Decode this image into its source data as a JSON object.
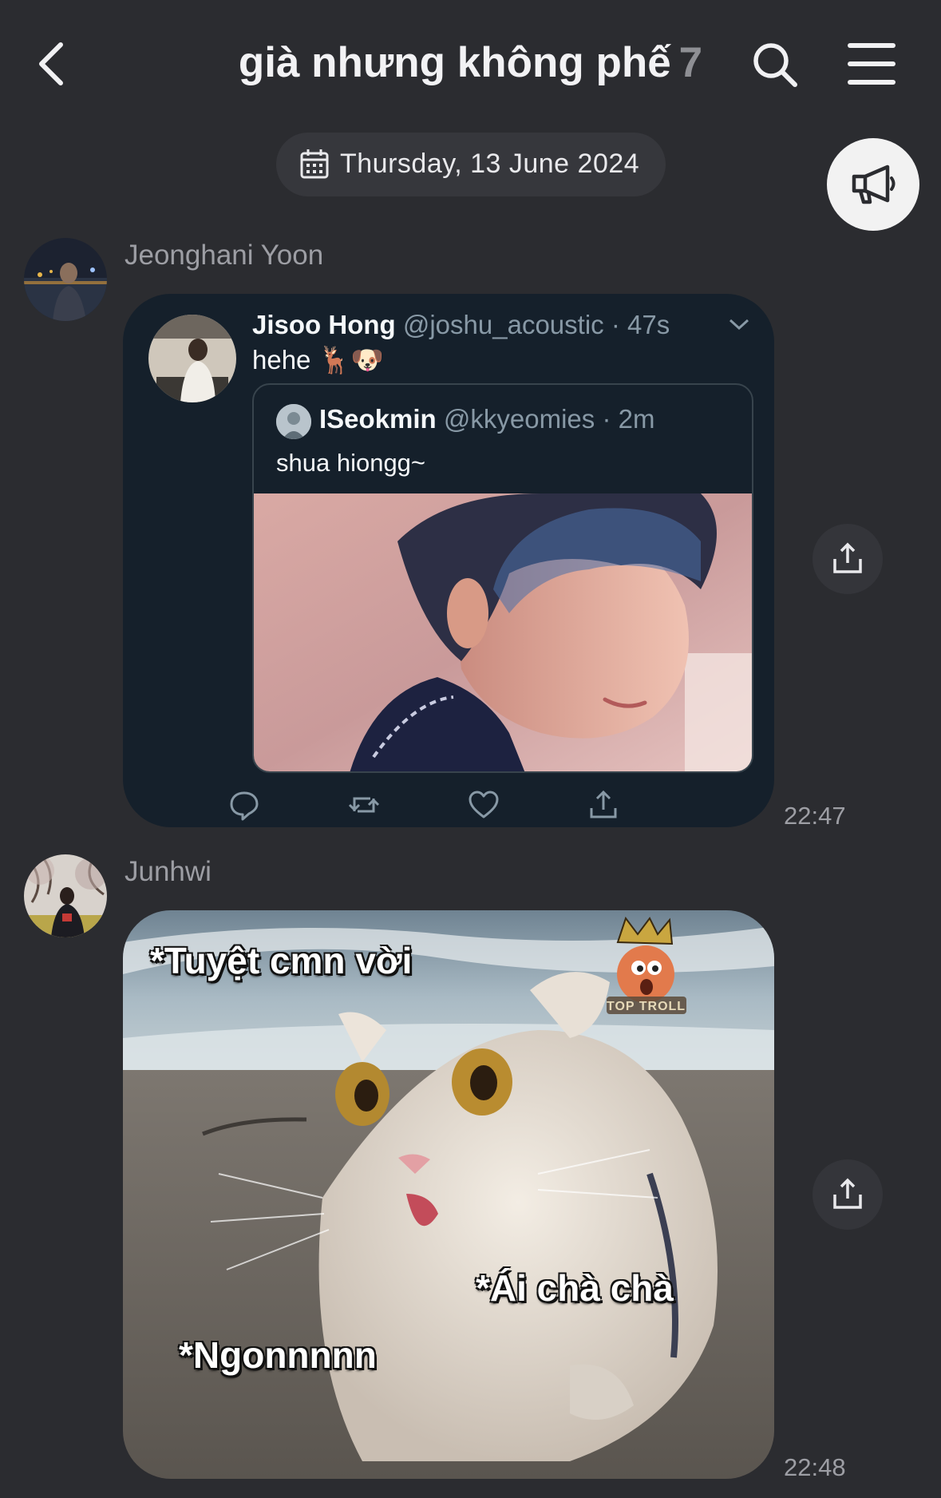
{
  "header": {
    "title": "già nhưng không phế",
    "member_count": "7"
  },
  "date_pill": {
    "label": "Thursday, 13 June 2024"
  },
  "messages": [
    {
      "sender": "Jeonghani Yoon",
      "time": "22:47",
      "tweet": {
        "name": "Jisoo Hong",
        "handle": "@joshu_acoustic",
        "age": "47s",
        "text": "hehe 🦌🐶",
        "quoted": {
          "name": "ISeokmin",
          "handle": "@kkyeomies",
          "age": "2m",
          "text": "shua hiongg~"
        },
        "actions": [
          "reply-icon",
          "retweet-icon",
          "like-icon",
          "share-icon"
        ]
      }
    },
    {
      "sender": "Junhwi",
      "time": "22:48",
      "meme": {
        "caption_top": "*Tuyệt cmn vời",
        "caption_mid": "*Ái chà chà",
        "caption_bottom": "*Ngonnnnn",
        "watermark": "TOP TROLL"
      }
    }
  ],
  "colors": {
    "background": "#2b2c30",
    "tweet_card": "#15202b",
    "announce_button": "#f2f2f2"
  }
}
